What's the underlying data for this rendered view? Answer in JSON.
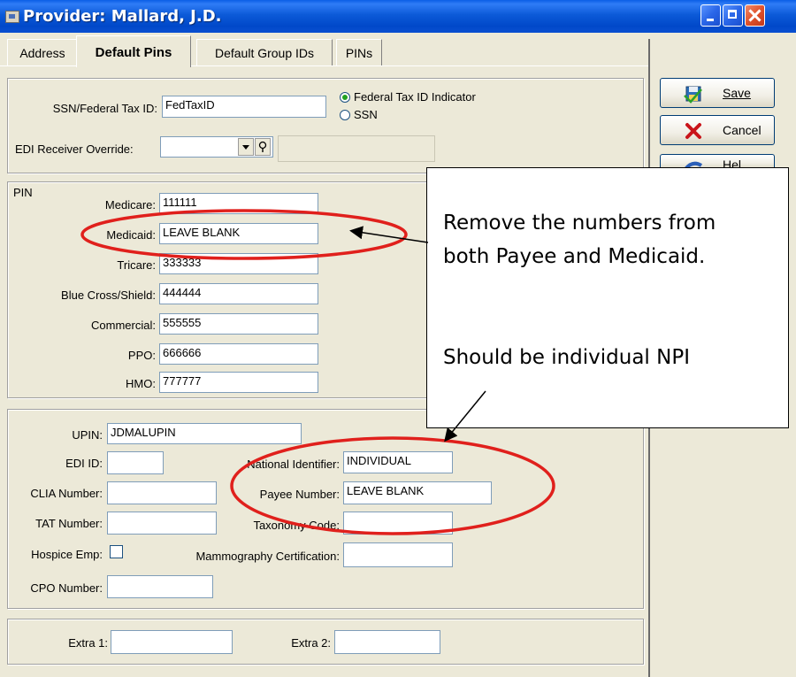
{
  "window": {
    "title": "Provider: Mallard, J.D."
  },
  "tabs": [
    {
      "label": "Address"
    },
    {
      "label": "Default Pins"
    },
    {
      "label": "Default Group IDs"
    },
    {
      "label": "PINs"
    }
  ],
  "top_section": {
    "ssn_label": "SSN/Federal Tax ID:",
    "ssn_value": "FedTaxID",
    "radio_federal": "Federal Tax ID Indicator",
    "radio_ssn": "SSN",
    "edi_label": "EDI Receiver Override:",
    "edi_value": ""
  },
  "pin_section": {
    "title": "PIN",
    "rows": [
      {
        "label": "Medicare:",
        "value": "111111"
      },
      {
        "label": "Medicaid:",
        "value": "LEAVE BLANK"
      },
      {
        "label": "Tricare:",
        "value": "333333"
      },
      {
        "label": "Blue Cross/Shield:",
        "value": "444444"
      },
      {
        "label": "Commercial:",
        "value": "555555"
      },
      {
        "label": "PPO:",
        "value": "666666"
      },
      {
        "label": "HMO:",
        "value": "777777"
      }
    ]
  },
  "ids_section": {
    "upin_label": "UPIN:",
    "upin_value": "JDMALUPIN",
    "edi_id_label": "EDI ID:",
    "edi_id_value": "",
    "clia_label": "CLIA Number:",
    "clia_value": "",
    "tat_label": "TAT Number:",
    "tat_value": "",
    "hospice_label": "Hospice Emp:",
    "cpo_label": "CPO Number:",
    "cpo_value": "",
    "national_label": "National Identifier:",
    "national_value": "INDIVIDUAL",
    "payee_label": "Payee Number:",
    "payee_value": "LEAVE BLANK",
    "taxonomy_label": "Taxonomy Code:",
    "taxonomy_value": "",
    "mammo_label": "Mammography Certification:",
    "mammo_value": ""
  },
  "extra_section": {
    "extra1_label": "Extra 1:",
    "extra1_value": "",
    "extra2_label": "Extra 2:",
    "extra2_value": ""
  },
  "buttons": {
    "save": "Save",
    "cancel": "Cancel",
    "help_partial": "Hel"
  },
  "callout": {
    "line1": "Remove the numbers from",
    "line2": "both Payee and Medicaid.",
    "line3": "Should be individual NPI"
  },
  "icons": {
    "save_icon": "floppy-icon",
    "cancel_icon": "red-x-icon",
    "help_icon": "help-book-icon",
    "edi_search": "magnifier-icon"
  },
  "colors": {
    "titlebar": "#0a5ee6",
    "annotation_red": "#e0201c",
    "dialog_bg": "#ece9d8"
  }
}
